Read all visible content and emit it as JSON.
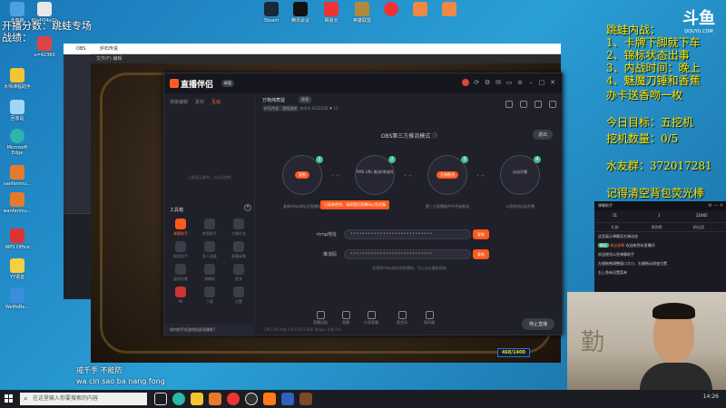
{
  "desktop": {
    "icons": [
      {
        "label": "此电脑"
      },
      {
        "label": "f0e4f04a1b"
      },
      {
        "label": "开播分数"
      },
      {
        "label": "跳蛙专场"
      },
      {
        "label": "大师课程助手"
      },
      {
        "label": "u=42360"
      },
      {
        "label": "回收站"
      },
      {
        "label": "Microsoft Edge"
      },
      {
        "label": "sanfanmu..."
      },
      {
        "label": "wanfanmu..."
      },
      {
        "label": "WPS Office"
      },
      {
        "label": "YY语音"
      },
      {
        "label": "WeMoBe..."
      },
      {
        "label": "Steam"
      },
      {
        "label": "腾讯会议"
      },
      {
        "label": "网易云"
      },
      {
        "label": "英雄联盟"
      }
    ]
  },
  "overlay": {
    "left_line1": "开播分数：跳蛙专场",
    "left_line2": "战绩：",
    "right_lines": [
      "跳蛙内战：",
      "1、卡牌下脚就下车",
      "2、锦标状态出事",
      "3、内战时间：晚上",
      "4、魅魔刀锤和香蕉",
      "办卡送香吻一枚",
      "今日目标：五挖机",
      "挖机数量：0/5",
      "水友群：372017281",
      "记得清空背包荧光棒"
    ],
    "douyu_logo": "斗鱼",
    "douyu_sub": "DOUYU.COM"
  },
  "obs_window": {
    "title": "OBS"
  },
  "game_window": {
    "title": "炉石传说",
    "menu": "文件(F)  编辑",
    "hp_text": "468/1400"
  },
  "dialog": {
    "logo": "直播伴侣",
    "version": "新版",
    "left_tabs": [
      "场景编辑",
      "素材",
      "互动"
    ],
    "empty_hint": "当前暂无素材，点击添加吧",
    "tools_title": "工具箱",
    "tools": [
      {
        "label": "弹幕助手"
      },
      {
        "label": "房管助手"
      },
      {
        "label": "主播任务"
      },
      {
        "label": "抽奖助手"
      },
      {
        "label": "多人连麦"
      },
      {
        "label": "屏幕录像"
      },
      {
        "label": "虚拟形象"
      },
      {
        "label": "弹幕姬"
      },
      {
        "label": "更多"
      },
      {
        "label": "PK"
      },
      {
        "label": "下载"
      },
      {
        "label": "设置"
      }
    ],
    "bottom_tip": "如何把手机游戏投屏直播呢?",
    "room_title": "万物炖煮鼠",
    "room_tag": "修改",
    "room_category": "炉石传说：酒馆战棋",
    "room_id": "房间号 9332526",
    "room_fans": "11",
    "mode_title": "OBS第三方推流模式",
    "exit_label": "退出",
    "steps": [
      {
        "num": "1",
        "label": "复制",
        "caption": "复制rtmp地址及直播码"
      },
      {
        "num": "2",
        "label": "RMS URL 推流/串流码",
        "caption": "粘贴到OBS设置中"
      },
      {
        "num": "3",
        "label": "开始推流",
        "caption": "第三方直播软件中开始推流"
      },
      {
        "num": "4",
        "label": "自动开播",
        "caption": "斗鱼房间自动开播"
      }
    ],
    "warn_text": "已复制密钥，请保管好直播码以免泄漏",
    "rtmp_label": "rtmp地址",
    "rtmp_value": "••••••••••••••••••••••••••••",
    "stream_label": "推流码",
    "stream_value": "••••••••••••••••••••••••••••",
    "copy_label": "复制",
    "field_hint": "若更换rtmp地址和直播码，可以点击重新获取",
    "footer_items": [
      "直播回放",
      "直播",
      "分享直播",
      "麦克风",
      "扬声器"
    ],
    "start_button": "停止直播",
    "status": "CPU 3%  内存 4%  FPS 0  码率 0Kbps  丢帧 0%"
  },
  "chat": {
    "title": "弹幕助手",
    "stat_left": "11",
    "stat_mid": "1",
    "stat_right": "22465",
    "tabs": [
      "礼物",
      "贵宾榜",
      "粉丝团"
    ],
    "messages": [
      {
        "text": "这里展示弹幕及礼物动态"
      },
      {
        "badge": "粉丝",
        "name": "粉丝勋章",
        "text": "欢迎来到本直播间"
      },
      {
        "text": "欢迎使用斗鱼弹幕助手"
      },
      {
        "text": "左键拖拽调整窗口大小，右键拖动改变位置"
      },
      {
        "text": "右上角有设置菜单"
      }
    ]
  },
  "webcam": {
    "calligraphy": "勤"
  },
  "subtitles": {
    "line1": "戒千手 不能防",
    "line2": "wa cin sao ba nang fong"
  },
  "taskbar": {
    "search_placeholder": "在这里输入你要搜索的内容",
    "tray_text": "14:26"
  }
}
